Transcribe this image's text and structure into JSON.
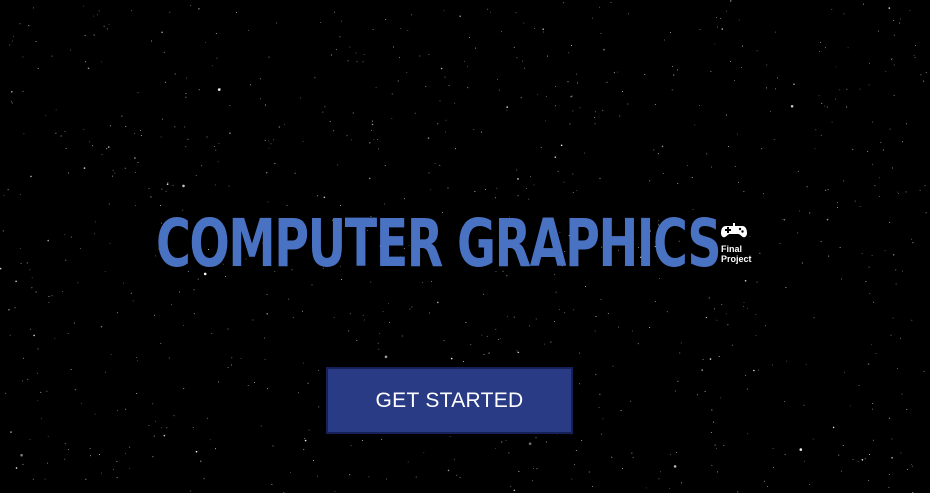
{
  "hero": {
    "title": "COMPUTER GRAPHICS",
    "badge": {
      "icon": "gamepad-icon",
      "line1": "Final",
      "line2": "Project"
    },
    "cta_label": "GET STARTED"
  },
  "colors": {
    "background": "#000000",
    "title": "#4a72c2",
    "button": "#2a3b86",
    "button_text": "#ffffff",
    "stars": "#ffffff"
  }
}
